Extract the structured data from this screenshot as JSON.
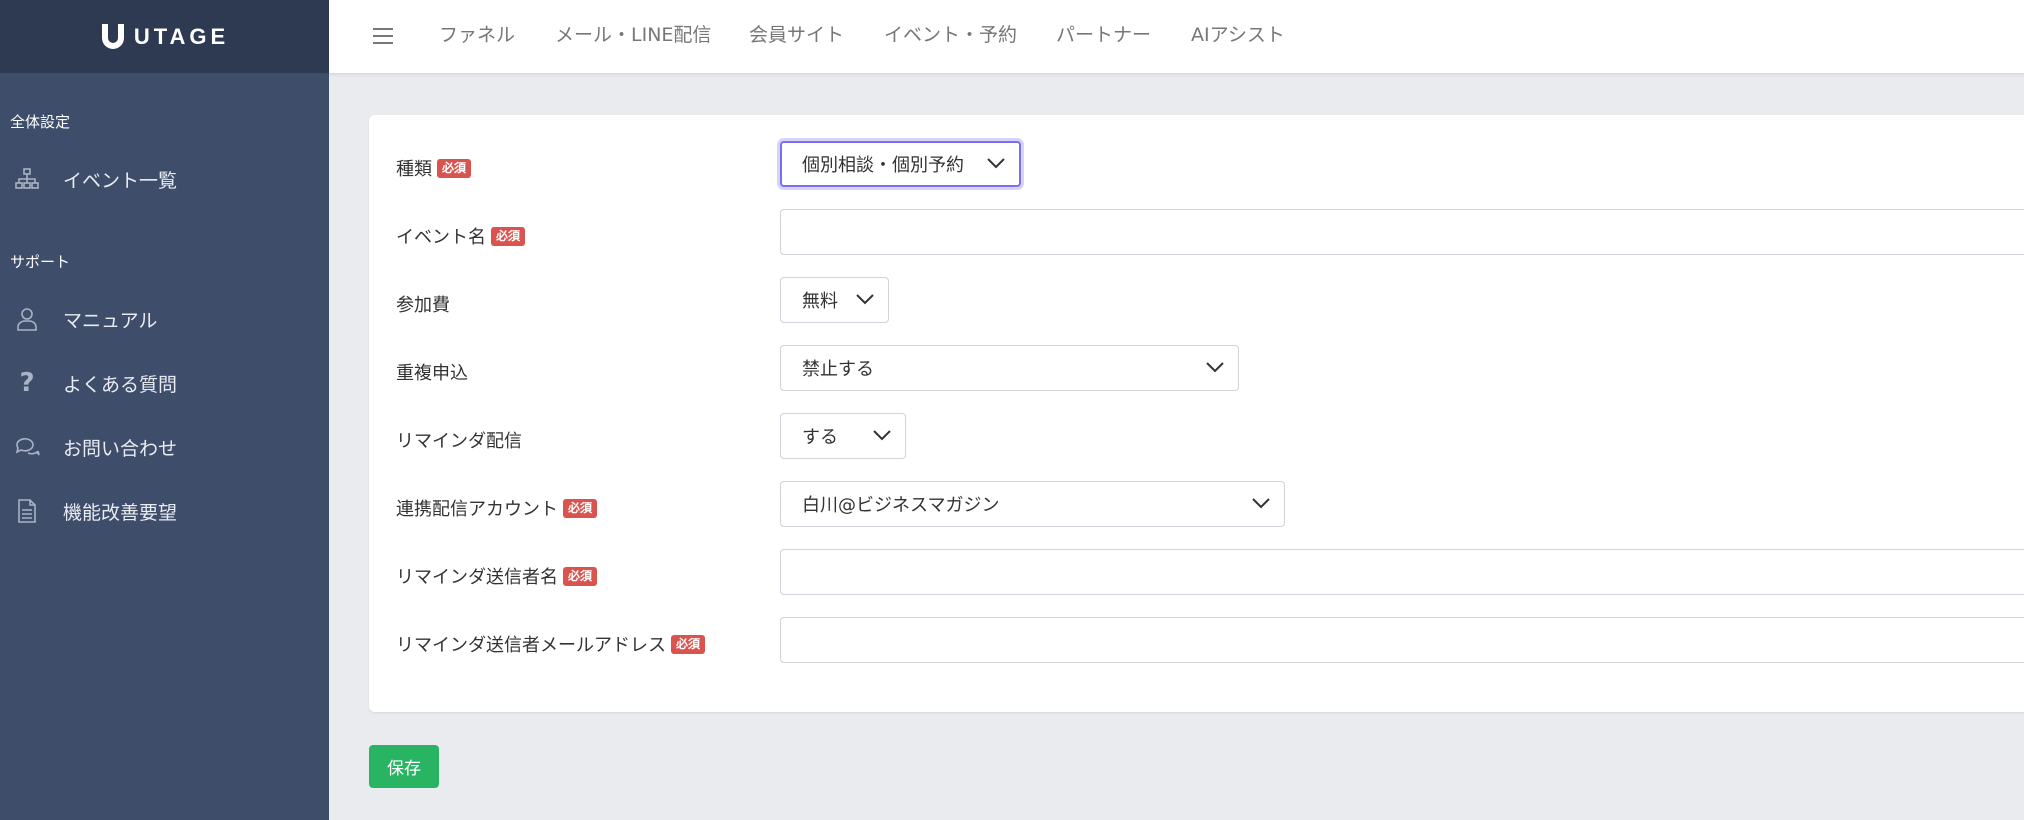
{
  "app": {
    "logo_text": "UTAGE"
  },
  "sidebar": {
    "section_global": "全体設定",
    "section_support": "サポート",
    "items": [
      {
        "label": "イベント一覧",
        "icon": "sitemap-icon"
      },
      {
        "label": "マニュアル",
        "icon": "user-icon"
      },
      {
        "label": "よくある質問",
        "icon": "question-icon"
      },
      {
        "label": "お問い合わせ",
        "icon": "chat-icon"
      },
      {
        "label": "機能改善要望",
        "icon": "document-icon"
      }
    ]
  },
  "topnav": {
    "items": [
      "ファネル",
      "メール・LINE配信",
      "会員サイト",
      "イベント・予約",
      "パートナー",
      "AIアシスト"
    ]
  },
  "form": {
    "required_badge": "必須",
    "type": {
      "label": "種類",
      "value": "個別相談・個別予約"
    },
    "event_name": {
      "label": "イベント名",
      "value": ""
    },
    "fee": {
      "label": "参加費",
      "value": "無料"
    },
    "duplicate": {
      "label": "重複申込",
      "value": "禁止する"
    },
    "reminder": {
      "label": "リマインダ配信",
      "value": "する"
    },
    "account": {
      "label": "連携配信アカウント",
      "value": "白川@ビジネスマガジン"
    },
    "sender_name": {
      "label": "リマインダ送信者名",
      "value": ""
    },
    "sender_email": {
      "label": "リマインダ送信者メールアドレス",
      "value": ""
    }
  },
  "actions": {
    "save_label": "保存"
  },
  "colors": {
    "sidebar_bg": "#3e4d6a",
    "sidebar_header_bg": "#2d3a52",
    "required_badge": "#d9534f",
    "save_button": "#28b463",
    "focus_border": "#7b6ef0"
  }
}
